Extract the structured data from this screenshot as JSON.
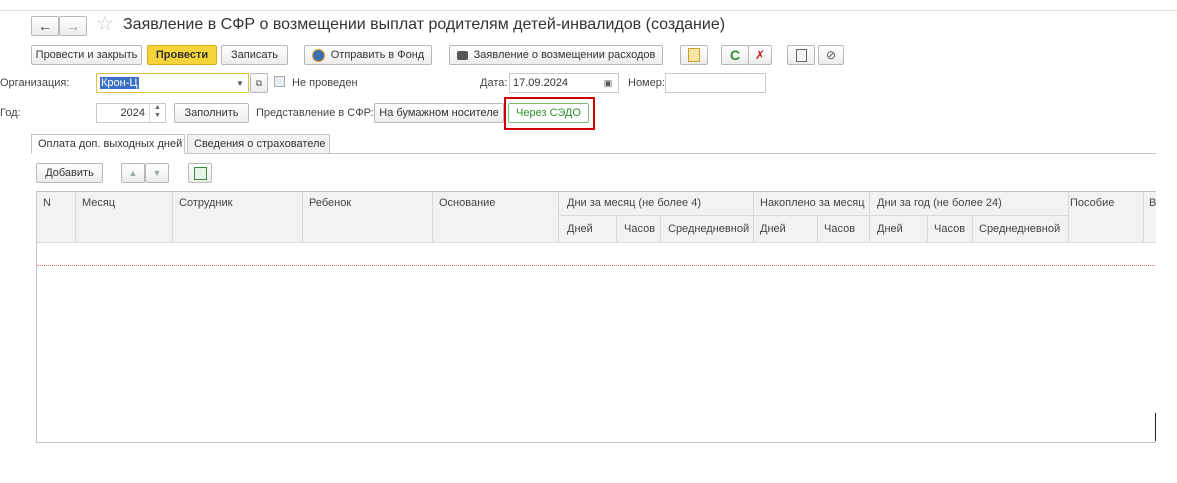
{
  "title": "Заявление в СФР о возмещении выплат родителям детей-инвалидов (создание)",
  "toolbar": {
    "post_close": "Провести и закрыть",
    "post": "Провести",
    "save": "Записать",
    "send_fund": "Отправить в Фонд",
    "print_application": "Заявление о возмещении расходов"
  },
  "form": {
    "org_label": "Организация:",
    "org_value": "Крон-Ц",
    "status": "Не проведен",
    "date_label": "Дата:",
    "date_value": "17.09.2024",
    "number_label": "Номер:",
    "number_value": "",
    "year_label": "Год:",
    "year_value": "2024",
    "fill_button": "Заполнить",
    "submission_label": "Представление в СФР:",
    "submission_paper": "На бумажном носителе",
    "submission_sedo": "Через СЭДО"
  },
  "tabs": [
    "Оплата доп. выходных дней",
    "Сведения о страхователе"
  ],
  "table_toolbar": {
    "add": "Добавить"
  },
  "table": {
    "columns": {
      "n": "N",
      "month": "Месяц",
      "employee": "Сотрудник",
      "child": "Ребенок",
      "basis": "Основание",
      "days_month": "Дни за месяц (не более 4)",
      "accum_month": "Накоплено за месяц",
      "days_year": "Дни за год (не более 24)",
      "benefit": "Пособие",
      "cut": "В"
    },
    "sub": {
      "dm_days": "Дней",
      "dm_hours": "Часов",
      "dm_avg": "Среднедневной",
      "am_days": "Дней",
      "am_hours": "Часов",
      "dy_days": "Дней",
      "dy_hours": "Часов",
      "dy_avg": "Среднедневной"
    }
  },
  "colors": {
    "primary_button": "#f5d33a",
    "highlight_border": "#d00000",
    "sedo_text": "#2f8f2f",
    "selection": "#3b6fc4"
  },
  "icons": [
    "back-arrow-icon",
    "forward-arrow-icon",
    "star-icon",
    "fund-icon",
    "printer-icon",
    "report-icon",
    "refresh-icon",
    "clear-icon",
    "document-icon",
    "attach-icon",
    "open-icon",
    "move-up-icon",
    "move-down-icon",
    "excel-icon",
    "calendar-icon",
    "dropdown-icon",
    "spin-icon"
  ]
}
